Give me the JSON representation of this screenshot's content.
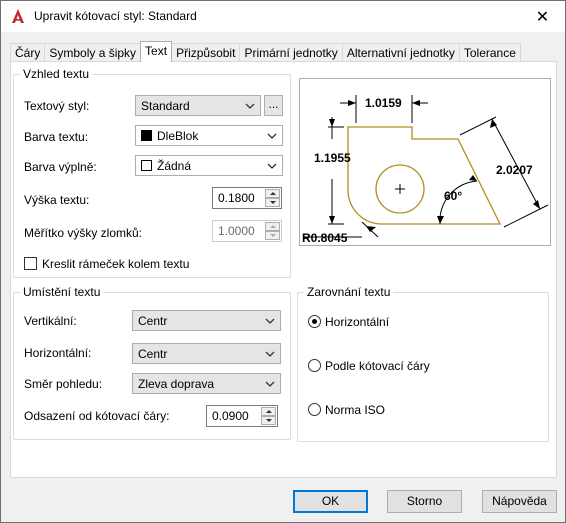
{
  "window": {
    "title": "Upravit kótovací styl: Standard",
    "close_glyph": "✕",
    "app_icon": "autocad-logo-icon"
  },
  "tabs": [
    {
      "label": "Čáry"
    },
    {
      "label": "Symboly a šipky"
    },
    {
      "label": "Text"
    },
    {
      "label": "Přizpůsobit"
    },
    {
      "label": "Primární jednotky"
    },
    {
      "label": "Alternativní jednotky"
    },
    {
      "label": "Tolerance"
    }
  ],
  "active_tab": "Text",
  "appearance": {
    "legend": "Vzhled textu",
    "text_style_label": "Textový styl:",
    "text_style_value": "Standard",
    "browse_label": "...",
    "text_color_label": "Barva textu:",
    "text_color_value": "DleBlok",
    "fill_color_label": "Barva výplně:",
    "fill_color_value": "Žádná",
    "text_height_label": "Výška textu:",
    "text_height_value": "0.1800",
    "fraction_scale_label": "Měřítko výšky zlomků:",
    "fraction_scale_value": "1.0000",
    "frame_checkbox_label": "Kreslit rámeček kolem textu",
    "frame_checked": false
  },
  "placement": {
    "legend": "Umístění textu",
    "vertical_label": "Vertikální:",
    "vertical_value": "Centr",
    "horizontal_label": "Horizontální:",
    "horizontal_value": "Centr",
    "view_direction_label": "Směr pohledu:",
    "view_direction_value": "Zleva doprava",
    "offset_label": "Odsazení od kótovací čáry:",
    "offset_value": "0.0900"
  },
  "alignment": {
    "legend": "Zarovnání textu",
    "options": [
      {
        "label": "Horizontální",
        "checked": true
      },
      {
        "label": "Podle kótovací čáry",
        "checked": false
      },
      {
        "label": "Norma ISO",
        "checked": false
      }
    ]
  },
  "preview": {
    "dim_top": "1.0159",
    "dim_left": "1.1955",
    "dim_right": "2.0207",
    "dim_angle": "60°",
    "dim_radius": "R0.8045",
    "colors": {
      "outline": "#b08f1d",
      "dim": "#000000"
    }
  },
  "buttons": {
    "ok": "OK",
    "cancel": "Storno",
    "help": "Nápověda"
  },
  "colors": {
    "accent": "#0078d7",
    "app_icon": "#c1272d"
  }
}
